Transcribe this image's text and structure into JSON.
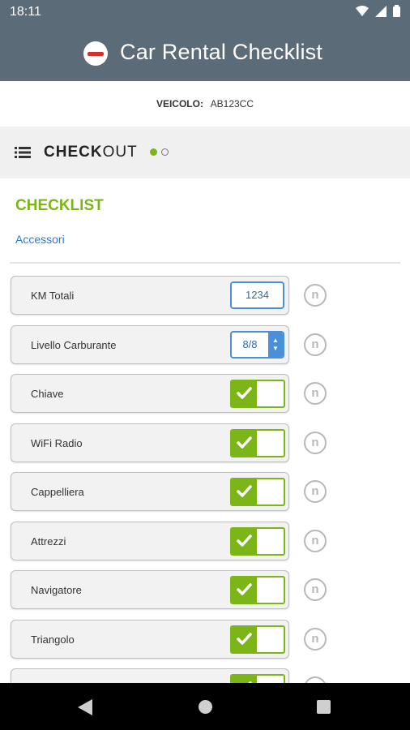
{
  "status_bar": {
    "time": "18:11",
    "icons": [
      "wifi-icon",
      "signal-icon",
      "battery-icon"
    ]
  },
  "app_bar": {
    "title": "Car Rental Checklist",
    "logo": "car-rental-logo"
  },
  "vehicle": {
    "label": "VEICOLO:",
    "plate": "AB123CC"
  },
  "phase": {
    "bold": "CHECK",
    "light": "OUT",
    "step_current": 1,
    "step_total": 2
  },
  "section": {
    "title": "CHECKLIST",
    "link": "Accessori"
  },
  "items": [
    {
      "label": "KM Totali",
      "control": "number",
      "value": "1234"
    },
    {
      "label": "Livello Carburante",
      "control": "select",
      "value": "8/8"
    },
    {
      "label": "Chiave",
      "control": "toggle",
      "checked": true
    },
    {
      "label": "WiFi Radio",
      "control": "toggle",
      "checked": true
    },
    {
      "label": "Cappelliera",
      "control": "toggle",
      "checked": true
    },
    {
      "label": "Attrezzi",
      "control": "toggle",
      "checked": true
    },
    {
      "label": "Navigatore",
      "control": "toggle",
      "checked": true
    },
    {
      "label": "Triangolo",
      "control": "toggle",
      "checked": true
    },
    {
      "label": "",
      "control": "toggle",
      "checked": true
    }
  ],
  "info_glyph": "n",
  "colors": {
    "appbar": "#5c6b78",
    "accent_green": "#7cb518",
    "link_blue": "#2b7bd1"
  }
}
